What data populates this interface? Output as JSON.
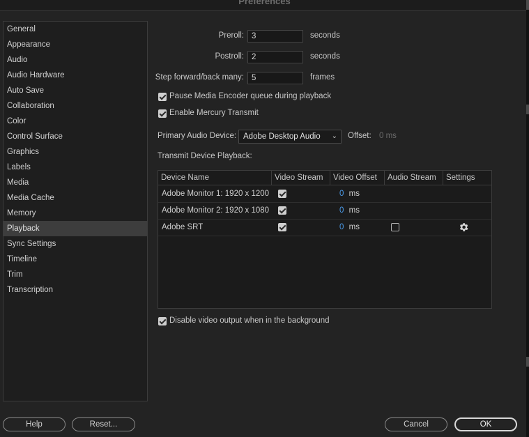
{
  "window": {
    "title": "Preferences"
  },
  "sidebar": {
    "items": [
      {
        "label": "General"
      },
      {
        "label": "Appearance"
      },
      {
        "label": "Audio"
      },
      {
        "label": "Audio Hardware"
      },
      {
        "label": "Auto Save"
      },
      {
        "label": "Collaboration"
      },
      {
        "label": "Color"
      },
      {
        "label": "Control Surface"
      },
      {
        "label": "Graphics"
      },
      {
        "label": "Labels"
      },
      {
        "label": "Media"
      },
      {
        "label": "Media Cache"
      },
      {
        "label": "Memory"
      },
      {
        "label": "Playback"
      },
      {
        "label": "Sync Settings"
      },
      {
        "label": "Timeline"
      },
      {
        "label": "Trim"
      },
      {
        "label": "Transcription"
      }
    ],
    "selected": "Playback"
  },
  "playback": {
    "preroll": {
      "label": "Preroll:",
      "value": "3",
      "unit": "seconds"
    },
    "postroll": {
      "label": "Postroll:",
      "value": "2",
      "unit": "seconds"
    },
    "step": {
      "label": "Step forward/back many:",
      "value": "5",
      "unit": "frames"
    },
    "pause_encoder": {
      "label": "Pause Media Encoder queue during playback",
      "checked": true
    },
    "mercury": {
      "label": "Enable Mercury Transmit",
      "checked": true
    },
    "audio_device": {
      "label": "Primary Audio Device:",
      "value": "Adobe Desktop Audio"
    },
    "offset": {
      "label": "Offset:",
      "value": "0 ms"
    },
    "transmit_label": "Transmit Device Playback:",
    "table": {
      "headers": [
        "Device Name",
        "Video Stream",
        "Video Offset",
        "Audio Stream",
        "Settings"
      ],
      "rows": [
        {
          "name": "Adobe Monitor 1: 1920 x 1200",
          "video_stream": true,
          "offset": "0",
          "unit": "ms",
          "audio_stream": null,
          "settings": false
        },
        {
          "name": "Adobe Monitor 2: 1920 x 1080",
          "video_stream": true,
          "offset": "0",
          "unit": "ms",
          "audio_stream": null,
          "settings": false
        },
        {
          "name": "Adobe SRT",
          "video_stream": true,
          "offset": "0",
          "unit": "ms",
          "audio_stream": false,
          "settings": true
        }
      ]
    },
    "disable_bg": {
      "label": "Disable video output when in the background",
      "checked": true
    }
  },
  "buttons": {
    "help": "Help",
    "reset": "Reset...",
    "cancel": "Cancel",
    "ok": "OK"
  },
  "icons": {
    "settings": "gear-icon",
    "dropdown": "chevron-down-icon",
    "checkbox": "checkmark-icon"
  },
  "colors": {
    "accent": "#4a9ae8",
    "background": "#232323",
    "selected": "#3d3d3d"
  }
}
